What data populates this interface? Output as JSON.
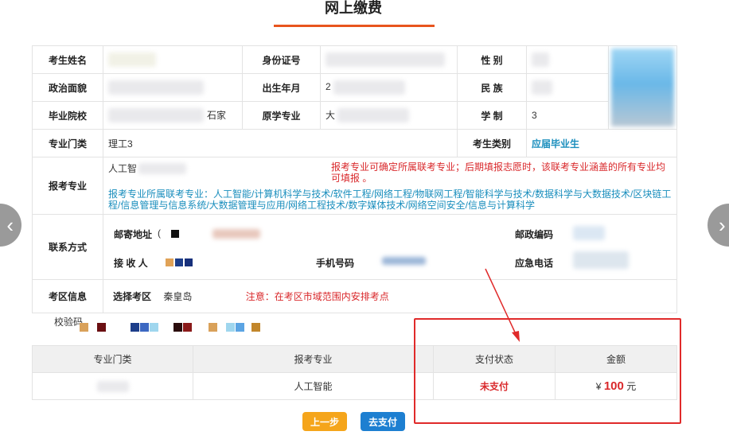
{
  "page_title": "网上缴费",
  "info": {
    "name_label": "考生姓名",
    "id_label": "身份证号",
    "gender_label": "性 别",
    "politics_label": "政治面貌",
    "birth_label": "出生年月",
    "birth_value": "2",
    "ethnic_label": "民 族",
    "school_label": "毕业院校",
    "school_fragment": "石家",
    "orig_major_label": "原学专业",
    "orig_major_value": "大",
    "duration_label": "学 制",
    "duration_value": "3",
    "category_label": "专业门类",
    "category_value": "理工3",
    "type_label": "考生类别",
    "type_value": "应届毕业生",
    "apply_label": "报考专业",
    "apply_value": "人工智",
    "apply_note": "报考专业可确定所属联考专业；后期填报志愿时，该联考专业涵盖的所有专业均可填报 。",
    "apply_list": "报考专业所属联考专业：人工智能/计算机科学与技术/软件工程/网络工程/物联网工程/智能科学与技术/数据科学与大数据技术/区块链工程/信息管理与信息系统/大数据管理与应用/网络工程技术/数字媒体技术/网络空间安全/信息与计算科学",
    "contact_label": "联系方式",
    "mail_addr_label": "邮寄地址",
    "mail_addr_value": "(",
    "postcode_label": "邮政编码",
    "receiver_label": "接 收 人",
    "phone_label": "手机号码",
    "emergency_label": "应急电话",
    "exam_area_label": "考区信息",
    "select_area_label": "选择考区",
    "select_area_value": "秦皇岛",
    "area_note": "注意：在考区市域范围内安排考点"
  },
  "verify_label": "校验码",
  "pay_table": {
    "headers": [
      "专业门类",
      "报考专业",
      "支付状态",
      "金额"
    ],
    "row": {
      "major": "人工智能",
      "status": "未支付",
      "currency": "¥",
      "amount": "100",
      "unit": "元"
    }
  },
  "buttons": {
    "prev": "上一步",
    "pay": "去支付"
  },
  "nav": {
    "prev": "‹",
    "next": "›"
  },
  "colors": {
    "accent": "#e8551e",
    "alert": "#d9282b",
    "link": "#1a8ebd",
    "prev_button": "#f5a51b",
    "pay_button": "#1d7fd1",
    "highlight_box": "#e02a2a"
  }
}
